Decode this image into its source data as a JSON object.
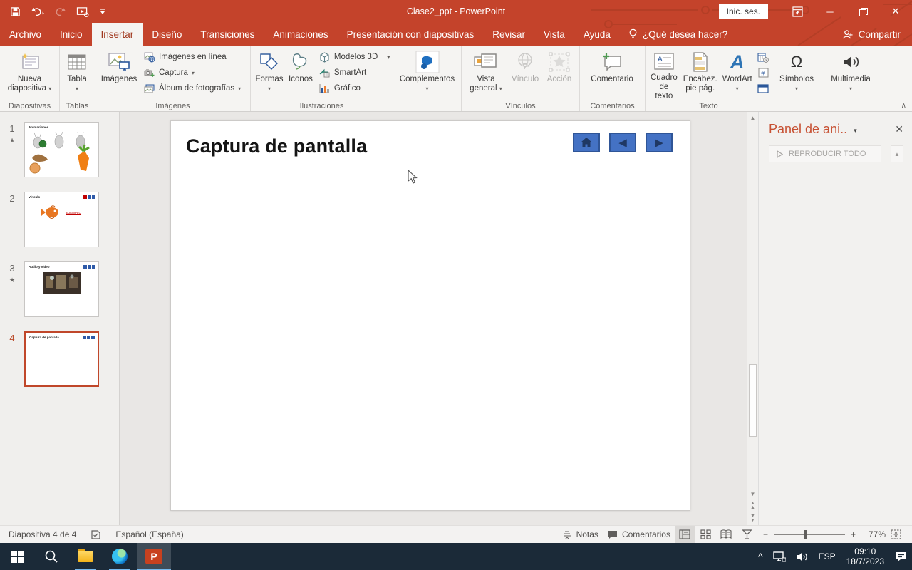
{
  "titlebar": {
    "title": "Clase2_ppt  -  PowerPoint",
    "signin": "Inic. ses."
  },
  "tabs": {
    "items": [
      {
        "label": "Archivo"
      },
      {
        "label": "Inicio"
      },
      {
        "label": "Insertar"
      },
      {
        "label": "Diseño"
      },
      {
        "label": "Transiciones"
      },
      {
        "label": "Animaciones"
      },
      {
        "label": "Presentación con diapositivas"
      },
      {
        "label": "Revisar"
      },
      {
        "label": "Vista"
      },
      {
        "label": "Ayuda"
      }
    ],
    "active": "Insertar",
    "search": "¿Qué desea hacer?",
    "share": "Compartir"
  },
  "ribbon": {
    "buttons": {
      "nueva_diapositiva": "Nueva diapositiva",
      "tabla": "Tabla",
      "imagenes": "Imágenes",
      "imagenes_en_linea": "Imágenes en línea",
      "captura": "Captura",
      "album": "Álbum de fotografías",
      "formas": "Formas",
      "iconos": "Iconos",
      "modelos_3d": "Modelos 3D",
      "smartart": "SmartArt",
      "grafico": "Gráfico",
      "complementos": "Complementos",
      "vista_general": "Vista general",
      "vinculo": "Vínculo",
      "accion": "Acción",
      "comentario": "Comentario",
      "cuadro_texto": "Cuadro de texto",
      "encabez": "Encabez. pie pág.",
      "wordart": "WordArt",
      "simbolos": "Símbolos",
      "multimedia": "Multimedia"
    },
    "groups": {
      "diapositivas": "Diapositivas",
      "tablas": "Tablas",
      "imagenes": "Imágenes",
      "ilustraciones": "Ilustraciones",
      "vinculos": "Vínculos",
      "comentarios": "Comentarios",
      "texto": "Texto"
    }
  },
  "thumbs": {
    "slides": [
      {
        "num": "1",
        "title": "Animaciones"
      },
      {
        "num": "2",
        "title": "Vínculo",
        "link_text": "EJEMPLO"
      },
      {
        "num": "3",
        "title": "Audio y video"
      },
      {
        "num": "4",
        "title": "Captura de pantalla"
      }
    ]
  },
  "canvas": {
    "title": "Captura de pantalla"
  },
  "anim_pane": {
    "title": "Panel de ani..",
    "play_all": "REPRODUCIR TODO"
  },
  "statusbar": {
    "slide_info": "Diapositiva 4 de 4",
    "language": "Español (España)",
    "notes": "Notas",
    "comments": "Comentarios",
    "zoom": "77%"
  },
  "taskbar": {
    "lang": "ESP",
    "time": "09:10",
    "date": "18/7/2023"
  },
  "icons": {
    "dropdown": "▾",
    "close": "✕",
    "minimize": "─",
    "collapse": "∧",
    "star": "★",
    "play": "▶",
    "tri_left": "◀",
    "tri_right": "▶",
    "up": "▲",
    "down": "▼",
    "up2": "▲▲",
    "down2": "▼▼",
    "minus": "−",
    "plus": "+",
    "tray_chevron": "^",
    "omega": "Ω",
    "hash": "#"
  },
  "colors": {
    "titlebar": "#c4432b",
    "active_tab_text": "#a0381f",
    "accent_button": "#4472c4",
    "accent_button_border": "#2f5597",
    "anim_title": "#c75133",
    "selected_thumb_border": "#c0472a",
    "taskbar": "#1b2a38",
    "running_indicator": "#76b9ed"
  }
}
